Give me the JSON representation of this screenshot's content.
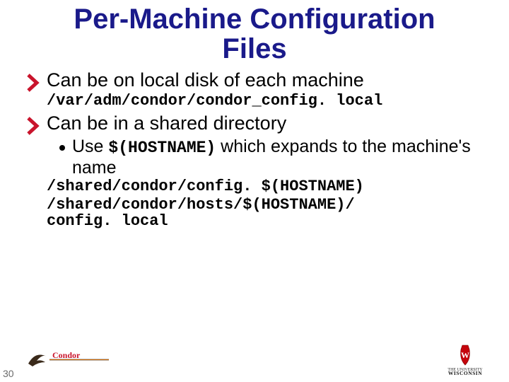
{
  "title_line1": "Per-Machine Configuration",
  "title_line2": "Files",
  "bullet1": "Can be on local disk of each machine",
  "mono1": "/var/adm/condor/condor_config. local",
  "bullet2": "Can be in a shared directory",
  "sub_pre": "Use ",
  "sub_code": "$(HOSTNAME)",
  "sub_post": " which expands to the machine's name",
  "mono2": "/shared/condor/config. $(HOSTNAME)",
  "mono3a": "/shared/condor/hosts/$(HOSTNAME)/",
  "mono3b": "config. local",
  "slide_number": "30",
  "condor_label": "Condor",
  "wisc_label": "WISCONSIN",
  "colors": {
    "title": "#1a1a8a",
    "chevron": "#c9142c",
    "wisc_red": "#c5050c"
  }
}
